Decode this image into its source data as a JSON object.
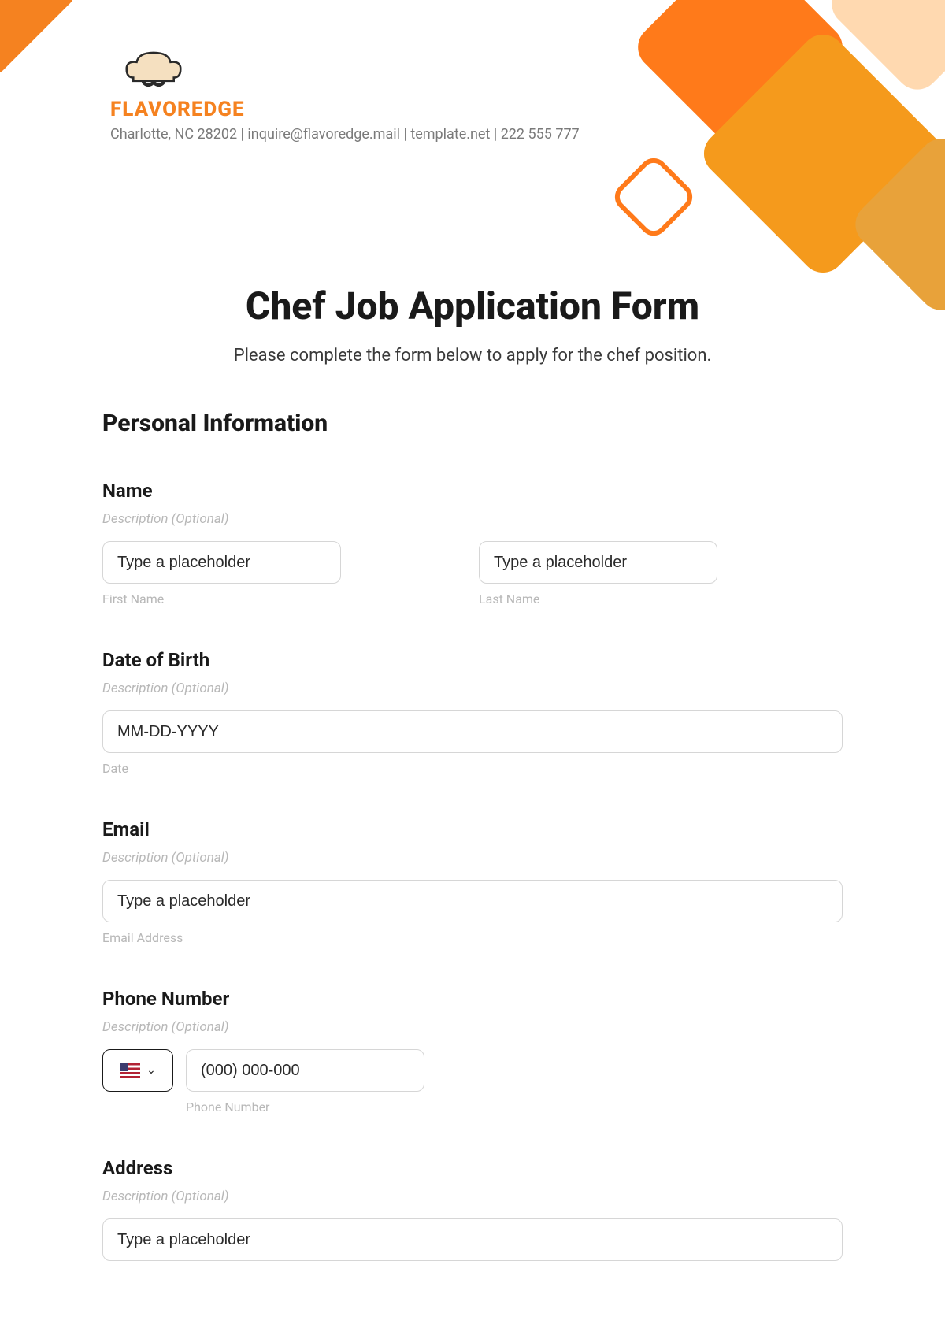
{
  "header": {
    "brand": "FLAVOREDGE",
    "contact": "Charlotte, NC 28202 | inquire@flavoredge.mail | template.net | 222 555 777"
  },
  "form": {
    "title": "Chef Job Application Form",
    "subtitle": "Please complete the form below to apply for the chef position.",
    "section_personal": "Personal Information",
    "desc_optional": "Description (Optional)",
    "fields": {
      "name": {
        "label": "Name",
        "first_ph": "Type a placeholder",
        "last_ph": "Type a placeholder",
        "first_sub": "First Name",
        "last_sub": "Last Name"
      },
      "dob": {
        "label": "Date of Birth",
        "ph": "MM-DD-YYYY",
        "sub": "Date"
      },
      "email": {
        "label": "Email",
        "ph": "Type a placeholder",
        "sub": "Email Address"
      },
      "phone": {
        "label": "Phone Number",
        "ph": "(000) 000-000",
        "sub": "Phone Number"
      },
      "address": {
        "label": "Address",
        "ph": "Type a placeholder"
      }
    }
  }
}
